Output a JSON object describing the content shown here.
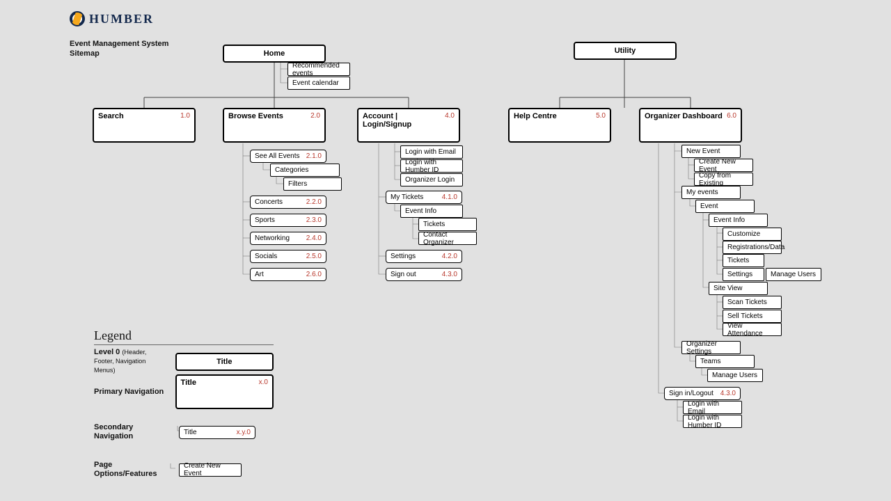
{
  "brand": "HUMBER",
  "doc_title_1": "Event Management System",
  "doc_title_2": "Sitemap",
  "home": "Home",
  "home_children": [
    "Recommended events",
    "Event calendar"
  ],
  "utility": "Utility",
  "p1": {
    "label": "Search",
    "code": "1.0"
  },
  "p2": {
    "label": "Browse Events",
    "code": "2.0"
  },
  "p3": {
    "label": "Account | Login/Signup",
    "code": "4.0"
  },
  "p4": {
    "label": "Help Centre",
    "code": "5.0"
  },
  "p5": {
    "label": "Organizer Dashboard",
    "code": "6.0"
  },
  "browse": [
    {
      "label": "See All Events",
      "code": "2.1.0"
    },
    {
      "label": "Concerts",
      "code": "2.2.0"
    },
    {
      "label": "Sports",
      "code": "2.3.0"
    },
    {
      "label": "Networking",
      "code": "2.4.0"
    },
    {
      "label": "Socials",
      "code": "2.5.0"
    },
    {
      "label": "Art",
      "code": "2.6.0"
    }
  ],
  "browse_opts": [
    "Categories",
    "Filters"
  ],
  "account_login": [
    "Login with Email",
    "Login with Humber ID",
    "Organizer Login"
  ],
  "account_secs": [
    {
      "label": "My Tickets",
      "code": "4.1.0"
    },
    {
      "label": "Settings",
      "code": "4.2.0"
    },
    {
      "label": "Sign out",
      "code": "4.3.0"
    }
  ],
  "account_mytickets": [
    "Event Info",
    "Tickets",
    "Contact Organizer"
  ],
  "org": {
    "newEvent": "New Event",
    "newEventOpts": [
      "Create New Event",
      "Copy from Existing"
    ],
    "myEvents": "My events",
    "event": "Event",
    "eventInfo": "Event Info",
    "eventInfoOpts": [
      "Customize",
      "Registrations/Data",
      "Tickets",
      "Settings"
    ],
    "manageUsers": "Manage Users",
    "siteView": "Site View",
    "siteViewOpts": [
      "Scan Tickets",
      "Sell Tickets",
      "View Attendance"
    ],
    "settings": "Organizer Settings",
    "teams": "Teams",
    "teamsOpt": "Manage Users",
    "sign": {
      "label": "Sign in/Logout",
      "code": "4.3.0"
    },
    "signOpts": [
      "Login with Email",
      "Login with Humber ID"
    ]
  },
  "legend": {
    "title": "Legend",
    "l0": "Level 0 ",
    "l0_sub": "(Header, Footer, Navigation Menus)",
    "l0_box": "Title",
    "l1": "Primary Navigation",
    "l1_box": {
      "label": "Title",
      "code": "x.0"
    },
    "l2": "Secondary Navigation",
    "l2_box": {
      "label": "Title",
      "code": "x.y.0"
    },
    "l3": "Page Options/Features",
    "l3_box": "Create New Event"
  }
}
